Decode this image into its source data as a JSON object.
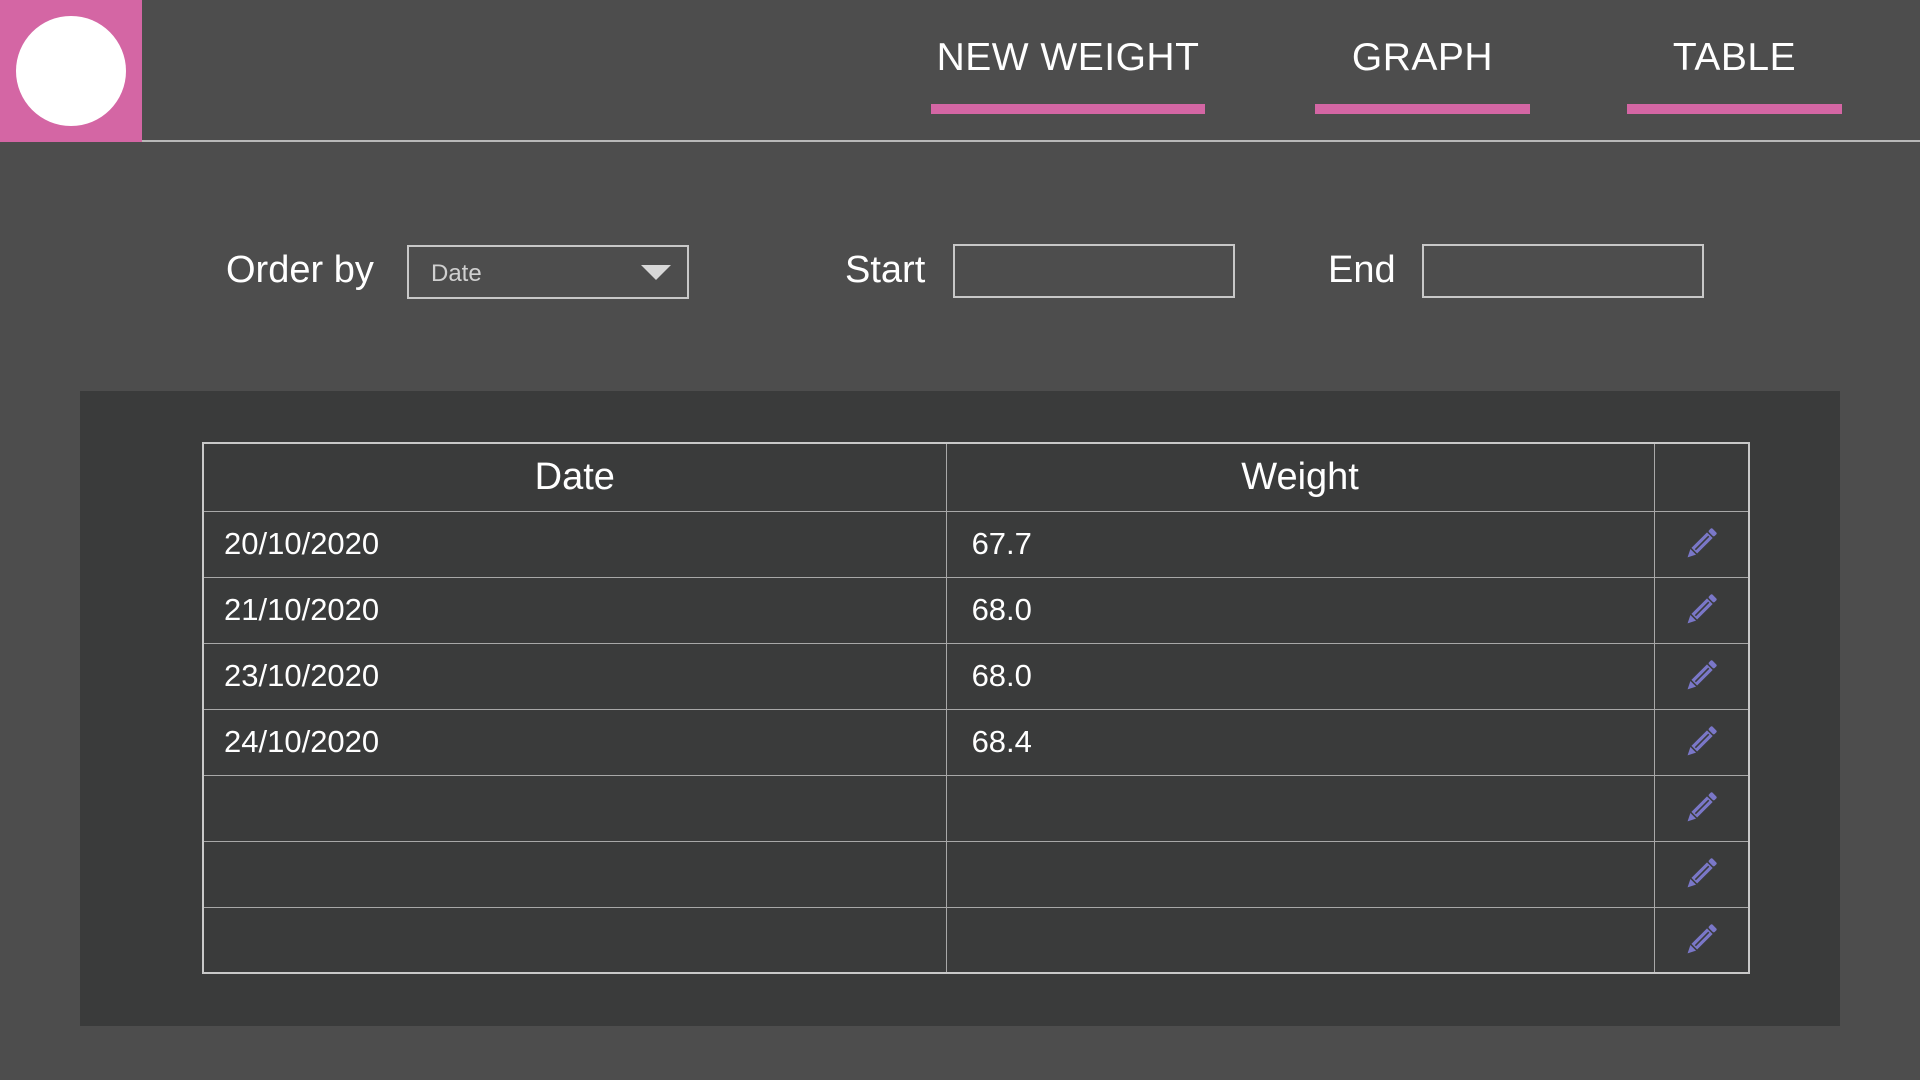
{
  "nav": {
    "tabs": [
      {
        "label": "NEW WEIGHT"
      },
      {
        "label": "GRAPH"
      },
      {
        "label": "TABLE"
      }
    ],
    "accent_color": "#d466a4"
  },
  "filters": {
    "order_label": "Order by",
    "order_value": "Date",
    "start_label": "Start",
    "start_value": "",
    "end_label": "End",
    "end_value": ""
  },
  "table": {
    "headers": [
      "Date",
      "Weight",
      ""
    ],
    "rows": [
      {
        "date": "20/10/2020",
        "weight": "67.7"
      },
      {
        "date": "21/10/2020",
        "weight": "68.0"
      },
      {
        "date": "23/10/2020",
        "weight": "68.0"
      },
      {
        "date": "24/10/2020",
        "weight": "68.4"
      },
      {
        "date": "",
        "weight": ""
      },
      {
        "date": "",
        "weight": ""
      },
      {
        "date": "",
        "weight": ""
      }
    ],
    "edit_icon": "pencil-icon",
    "edit_icon_color": "#7a77c8"
  }
}
